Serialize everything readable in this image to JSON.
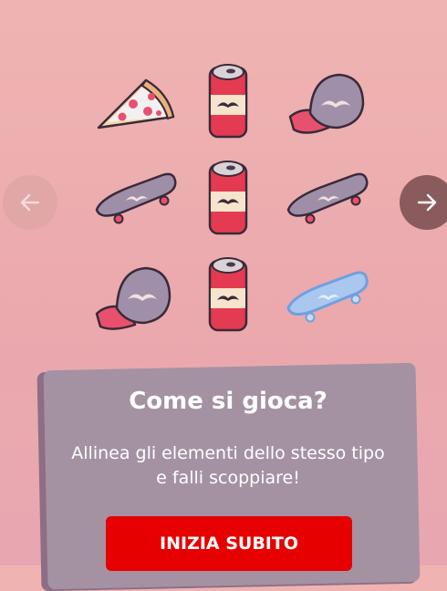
{
  "game": {
    "board": [
      [
        "pizza",
        "soda-can",
        "cap"
      ],
      [
        "skateboard",
        "soda-can",
        "skateboard"
      ],
      [
        "cap",
        "soda-can",
        "skateboard-highlighted"
      ]
    ]
  },
  "navigation": {
    "prev_icon": "arrow-left-icon",
    "next_icon": "arrow-right-icon"
  },
  "tutorial": {
    "title": "Come si gioca?",
    "line1": "Allinea gli elementi dello stesso tipo",
    "line2": "e falli scoppiare!",
    "button_label": "INIZIA SUBITO"
  },
  "colors": {
    "accent": "#e60000",
    "card": "#a492a3",
    "background": "#efb4b1"
  }
}
